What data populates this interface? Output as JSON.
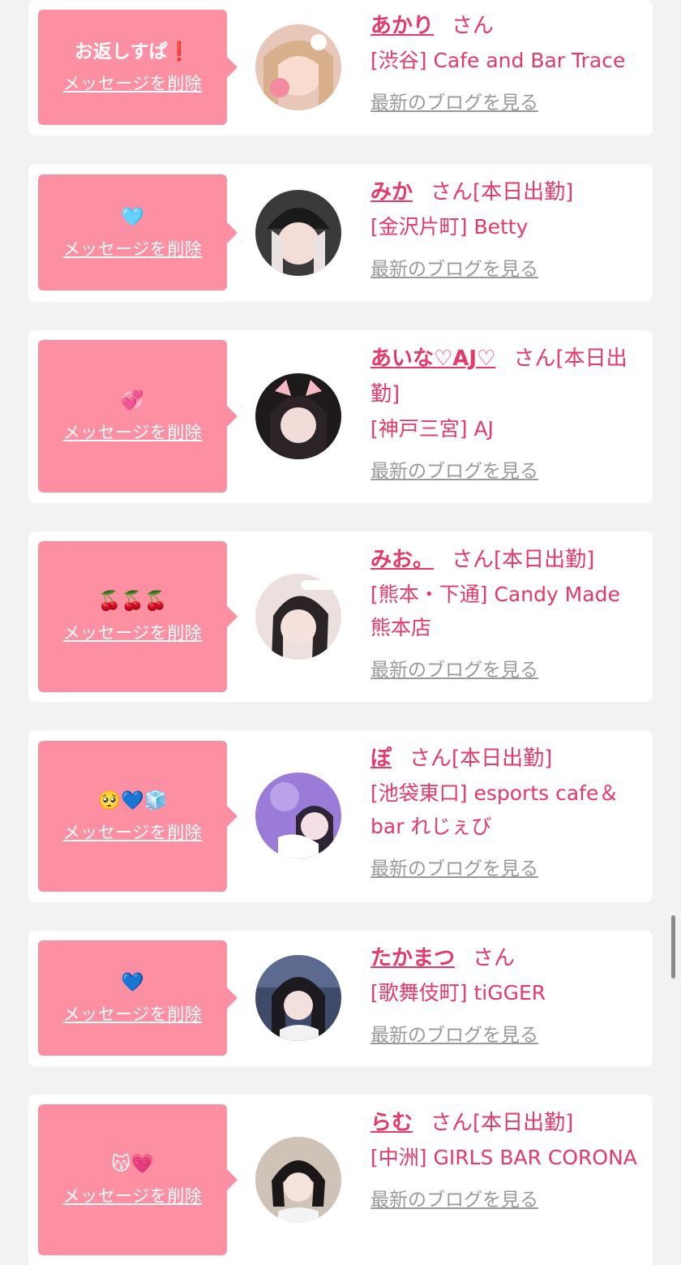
{
  "cards": [
    {
      "message": "お返しすぱ❗️",
      "delete_label": "メッセージを削除",
      "name": "あかり",
      "honorific": "さん",
      "status": "",
      "shop": "[渋谷] Cafe and Bar Trace",
      "blog_label": "最新のブログを見る"
    },
    {
      "message": "🩵",
      "delete_label": "メッセージを削除",
      "name": "みか",
      "honorific": "さん",
      "status": "[本日出勤]",
      "shop": "[金沢片町] Betty",
      "blog_label": "最新のブログを見る"
    },
    {
      "message": "💞",
      "delete_label": "メッセージを削除",
      "name": "あいな♡AJ♡",
      "honorific": "さん",
      "status": "[本日出勤]",
      "shop": "[神戸三宮] AJ",
      "blog_label": "最新のブログを見る"
    },
    {
      "message": "🍒🍒🍒",
      "delete_label": "メッセージを削除",
      "name": "みお。",
      "honorific": "さん",
      "status": "[本日出勤]",
      "shop": "[熊本・下通] Candy Made 熊本店",
      "blog_label": "最新のブログを見る"
    },
    {
      "message": "🥺💙🧊",
      "delete_label": "メッセージを削除",
      "name": "ぽ",
      "honorific": "さん",
      "status": "[本日出勤]",
      "shop": "[池袋東口] esports cafe＆bar れじぇび",
      "blog_label": "最新のブログを見る"
    },
    {
      "message": "💙",
      "delete_label": "メッセージを削除",
      "name": "たかまつ",
      "honorific": "さん",
      "status": "",
      "shop": "[歌舞伎町] tiGGER",
      "blog_label": "最新のブログを見る"
    },
    {
      "message": "😽💗",
      "delete_label": "メッセージを削除",
      "name": "らむ",
      "honorific": "さん",
      "status": "[本日出勤]",
      "shop": "[中洲] GIRLS BAR CORONA",
      "blog_label": "最新のブログを見る"
    }
  ],
  "colors": {
    "accent_pink": "#e5386b",
    "bubble_pink": "#fd8fa3",
    "blog_gray": "#9a9a9a",
    "background": "#f2f2f2"
  }
}
